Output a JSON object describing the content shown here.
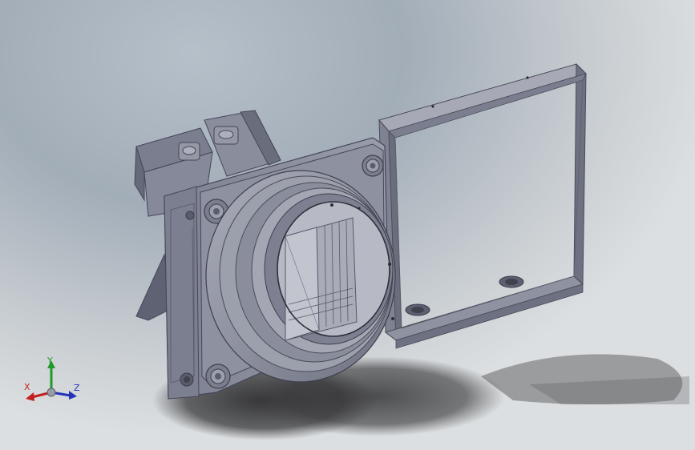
{
  "viewport": {
    "background_top": "#a2adb8",
    "background_bottom": "#dcdfe1",
    "part_color": "#8e91a0",
    "shadow_color": "#3c3c3e"
  },
  "triad": {
    "x_label": "X",
    "y_label": "Y",
    "z_label": "Z",
    "x_color": "#c21f1f",
    "y_color": "#1f9b2a",
    "z_color": "#2233b8"
  }
}
